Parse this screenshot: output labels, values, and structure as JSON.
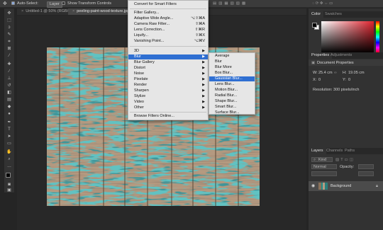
{
  "options_bar": {
    "auto_select_label": "Auto-Select:",
    "auto_select_value": "Layer",
    "transform_label": "Show Transform Controls"
  },
  "tabs": [
    {
      "title": "Untitled-1 @ 50% (RGB/8)"
    },
    {
      "title": "peeling-paint-wood-texture.jpg @"
    }
  ],
  "filter_menu": {
    "items": [
      {
        "label": "Convert for Smart Filters",
        "shortcut": ""
      },
      {
        "label": "Filter Gallery...",
        "shortcut": ""
      },
      {
        "label": "Adaptive Wide Angle...",
        "shortcut": "⌥⇧⌘A"
      },
      {
        "label": "Camera Raw Filter...",
        "shortcut": "⇧⌘A"
      },
      {
        "label": "Lens Correction...",
        "shortcut": "⇧⌘R"
      },
      {
        "label": "Liquify...",
        "shortcut": "⇧⌘X"
      },
      {
        "label": "Vanishing Point...",
        "shortcut": "⌥⌘V"
      },
      {
        "label": "3D",
        "shortcut": ""
      },
      {
        "label": "Blur",
        "shortcut": ""
      },
      {
        "label": "Blur Gallery",
        "shortcut": ""
      },
      {
        "label": "Distort",
        "shortcut": ""
      },
      {
        "label": "Noise",
        "shortcut": ""
      },
      {
        "label": "Pixelate",
        "shortcut": ""
      },
      {
        "label": "Render",
        "shortcut": ""
      },
      {
        "label": "Sharpen",
        "shortcut": ""
      },
      {
        "label": "Stylize",
        "shortcut": ""
      },
      {
        "label": "Video",
        "shortcut": ""
      },
      {
        "label": "Other",
        "shortcut": ""
      },
      {
        "label": "Browse Filters Online...",
        "shortcut": ""
      }
    ]
  },
  "blur_submenu": {
    "items": [
      "Average",
      "Blur",
      "Blur More",
      "Box Blur...",
      "Gaussian Blur...",
      "Lens Blur...",
      "Motion Blur...",
      "Radial Blur...",
      "Shape Blur...",
      "Smart Blur...",
      "Surface Blur..."
    ],
    "highlighted": "Gaussian Blur..."
  },
  "color_panel": {
    "tabs": [
      "Color",
      "Swatches"
    ],
    "hue_color": "#e0232e"
  },
  "properties_panel": {
    "tabs": [
      "Properties",
      "Adjustments"
    ],
    "title": "Document Properties",
    "w_label": "W:",
    "w_value": "25.4 cm",
    "h_label": "H:",
    "h_value": "19.05 cm",
    "x_label": "X:",
    "x_value": "0",
    "y_label": "Y:",
    "y_value": "0",
    "resolution": "Resolution: 300 pixels/inch"
  },
  "layers_panel": {
    "tabs": [
      "Layers",
      "Channels",
      "Paths"
    ],
    "kind_label": "Kind",
    "blend_mode": "Normal",
    "opacity_label": "Opacity:",
    "layer_name": "Background"
  },
  "colors": {
    "highlight": "#2f6fd2",
    "teal_paint": "#1f8a8a",
    "wood": "#b59a80"
  }
}
